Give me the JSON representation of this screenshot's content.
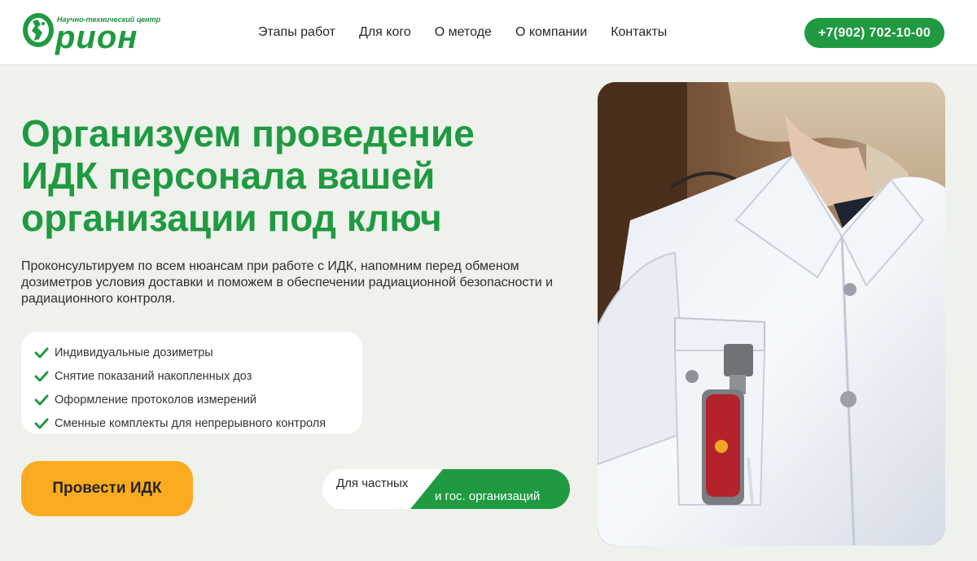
{
  "brand": {
    "subtitle": "Научно-технический центр",
    "name": "рион",
    "accent_color": "#1f9a41",
    "logo_icon": "orion-emblem"
  },
  "nav": {
    "items": [
      {
        "label": "Этапы работ"
      },
      {
        "label": "Для кого"
      },
      {
        "label": "О методе"
      },
      {
        "label": "О компании"
      },
      {
        "label": "Контакты"
      }
    ]
  },
  "header": {
    "phone": "+7(902) 702-10-00"
  },
  "hero": {
    "title": "Организуем проведение ИДК персонала вашей организации под ключ",
    "description": "Проконсультируем по всем нюансам при работе с ИДК, напомним перед обменом дозиметров условия доставки и поможем в обеспечении радиационной безопасности и радиационного контроля.",
    "features": [
      {
        "icon": "check-icon",
        "text": "Индивидуальные дозиметры"
      },
      {
        "icon": "check-icon",
        "text": "Снятие показаний накопленных доз"
      },
      {
        "icon": "check-icon",
        "text": "Оформление протоколов измерений"
      },
      {
        "icon": "check-icon",
        "text": "Сменные комплекты для непрерывного контроля"
      }
    ],
    "cta_label": "Провести ИДК",
    "cta_color": "#fbab1f",
    "badge": {
      "left_text": "Для частных",
      "right_text": "и гос. организаций"
    }
  }
}
